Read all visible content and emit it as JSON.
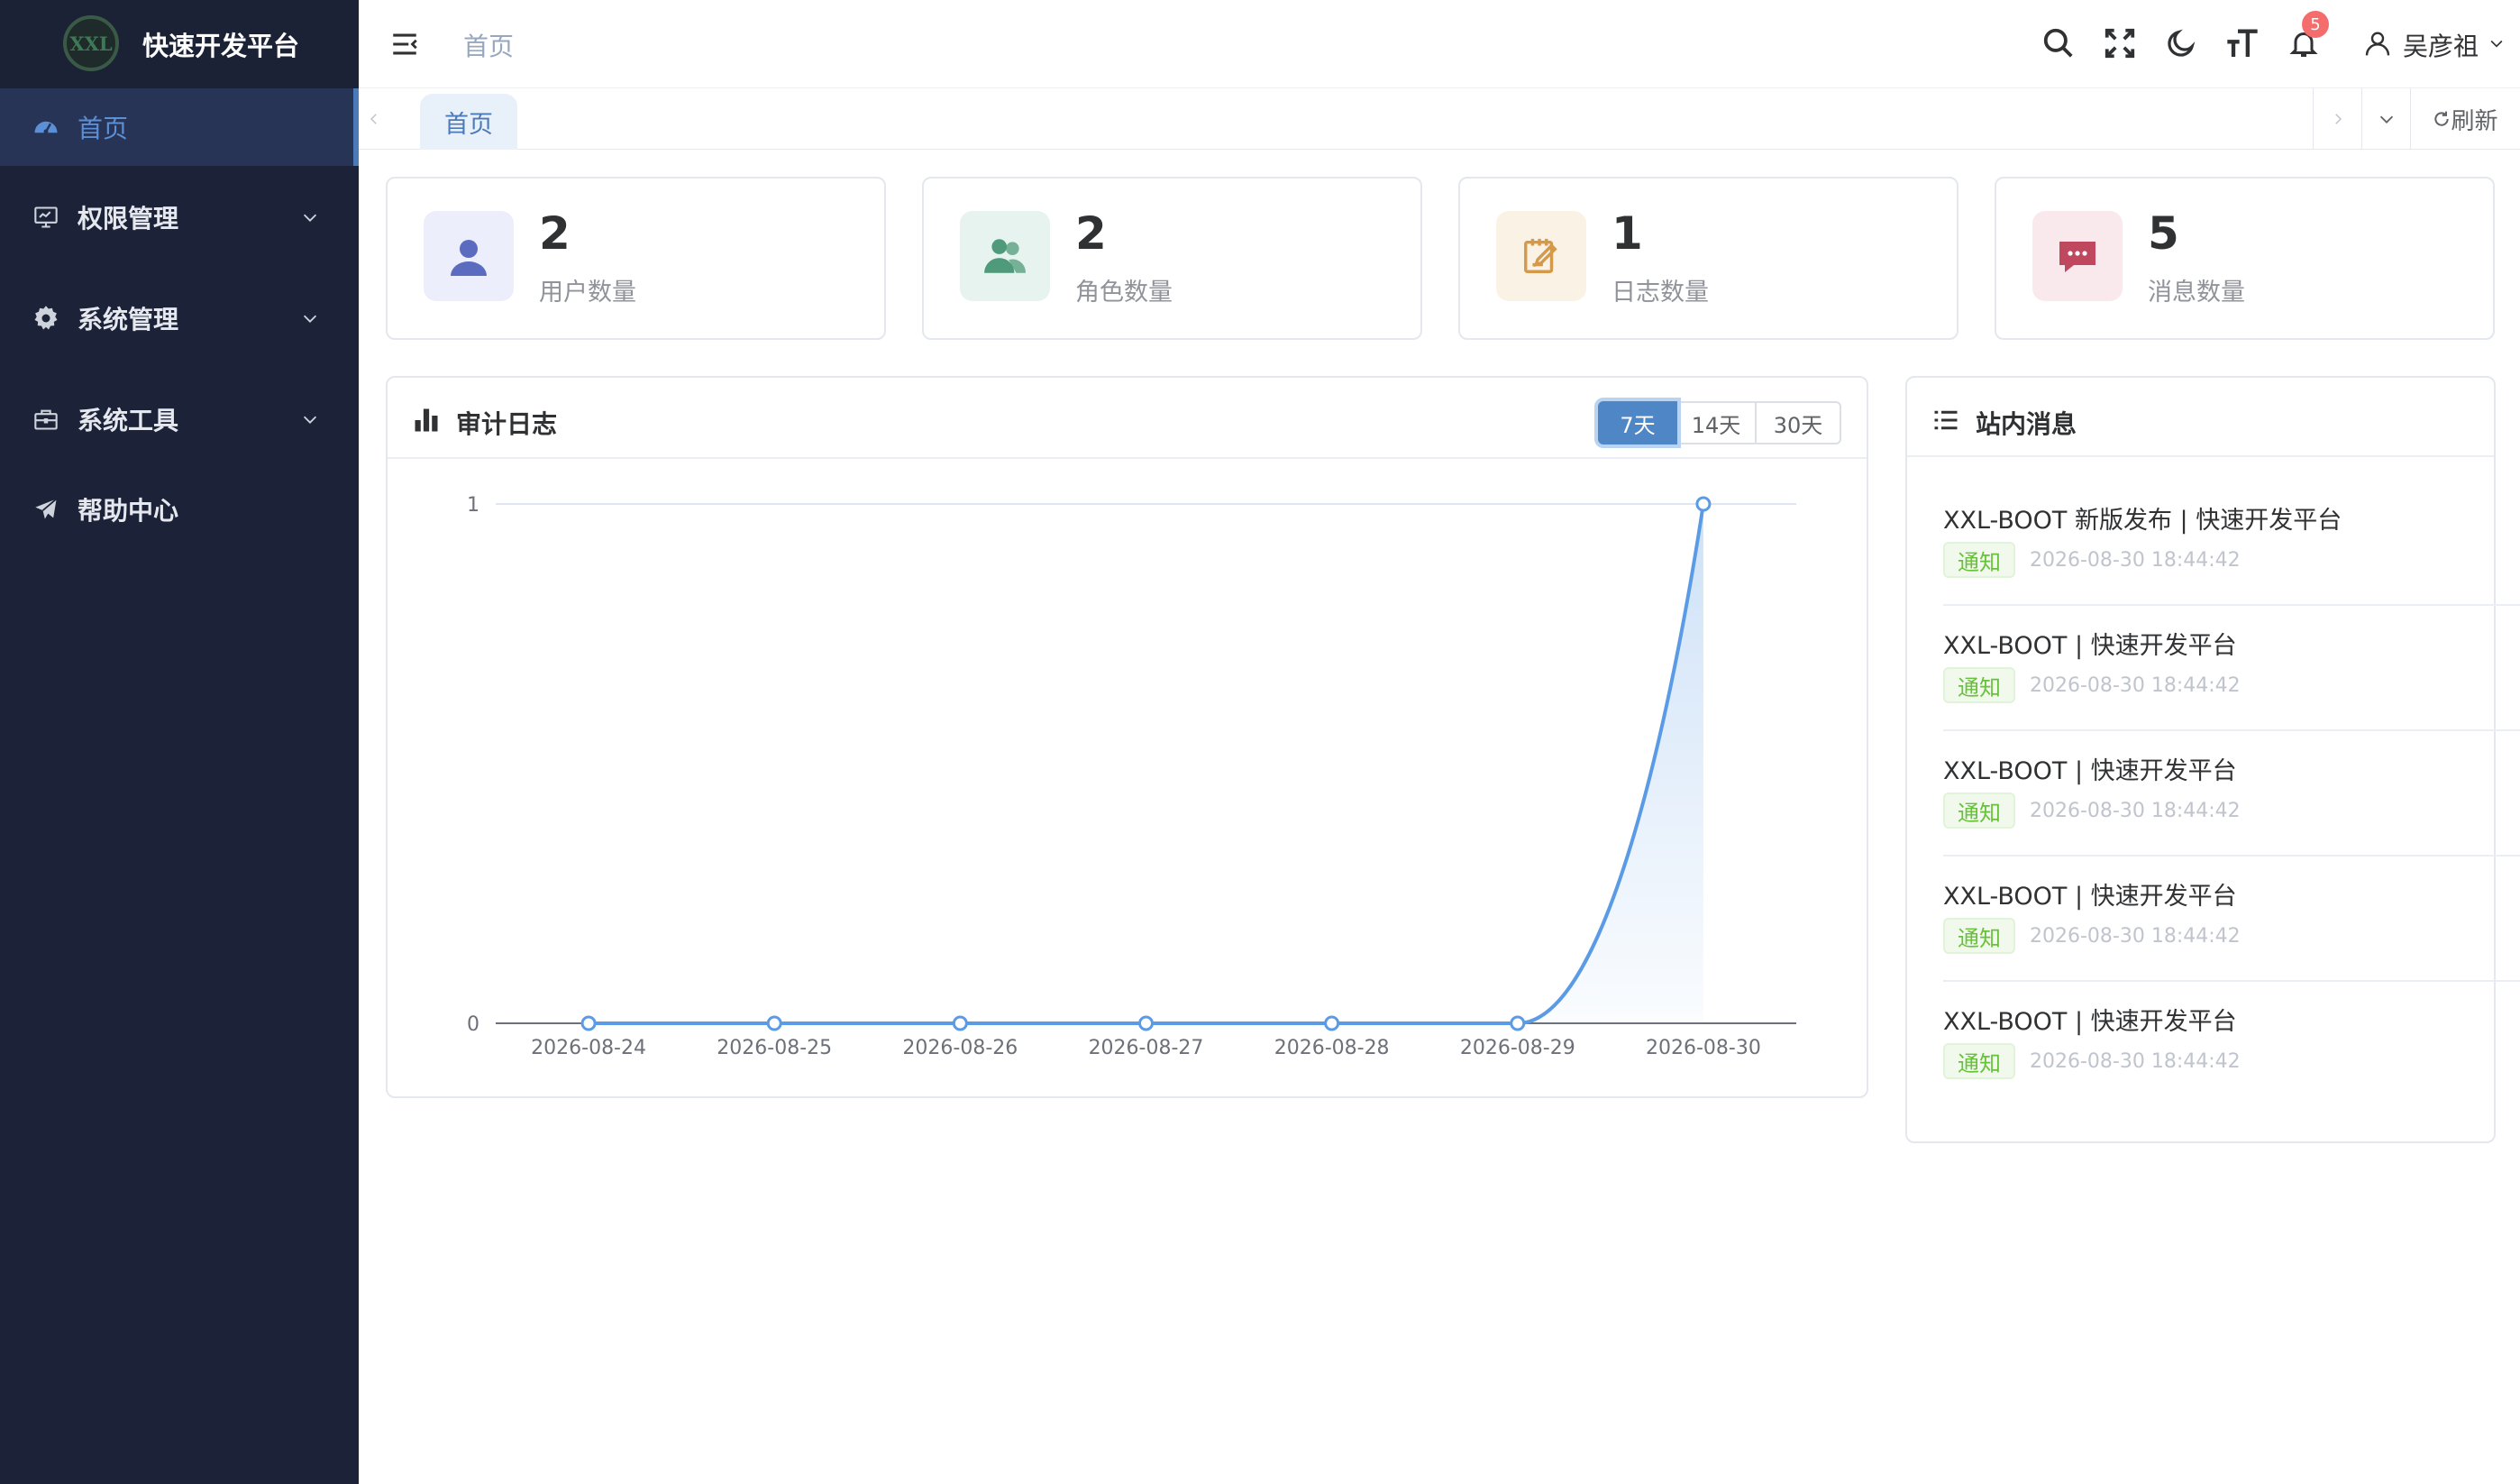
{
  "app": {
    "logo_text": "XXL",
    "title": "快速开发平台"
  },
  "sidebar": {
    "items": [
      {
        "label": "首页",
        "icon": "dashboard-icon",
        "active": true
      },
      {
        "label": "权限管理",
        "icon": "monitor-icon",
        "expandable": true
      },
      {
        "label": "系统管理",
        "icon": "gear-icon",
        "expandable": true
      },
      {
        "label": "系统工具",
        "icon": "briefcase-icon",
        "expandable": true
      },
      {
        "label": "帮助中心",
        "icon": "paper-plane-icon"
      }
    ]
  },
  "header": {
    "breadcrumb": "首页",
    "notification_count": "5",
    "user_name": "吴彦祖"
  },
  "tags": {
    "active_tag": "首页",
    "refresh_label": "刷新"
  },
  "stats": [
    {
      "value": "2",
      "label": "用户数量",
      "icon": "user-icon",
      "bg": "#eceefb",
      "color": "#5b6bc0"
    },
    {
      "value": "2",
      "label": "角色数量",
      "icon": "team-icon",
      "bg": "#e6f3ee",
      "color": "#4f9a7a"
    },
    {
      "value": "1",
      "label": "日志数量",
      "icon": "edit-icon",
      "bg": "#fbf2e6",
      "color": "#d49a4a"
    },
    {
      "value": "5",
      "label": "消息数量",
      "icon": "message-icon",
      "bg": "#f9e9ec",
      "color": "#c0485e"
    }
  ],
  "audit": {
    "title": "审计日志",
    "ranges": [
      "7天",
      "14天",
      "30天"
    ],
    "active_range": "7天"
  },
  "chart_data": {
    "type": "line",
    "categories": [
      "2026-08-24",
      "2026-08-25",
      "2026-08-26",
      "2026-08-27",
      "2026-08-28",
      "2026-08-29",
      "2026-08-30"
    ],
    "values": [
      0,
      0,
      0,
      0,
      0,
      0,
      1
    ],
    "y_ticks": [
      "0",
      "1"
    ],
    "ylim": [
      0,
      1
    ],
    "title": "",
    "xlabel": "",
    "ylabel": "",
    "smooth": true,
    "area_fill": true,
    "color": "#5b9be6"
  },
  "messages": {
    "title": "站内消息",
    "items": [
      {
        "title": "XXL-BOOT 新版发布 | 快速开发平台",
        "tag": "通知",
        "time": "2026-08-30 18:44:42"
      },
      {
        "title": "XXL-BOOT | 快速开发平台",
        "tag": "通知",
        "time": "2026-08-30 18:44:42"
      },
      {
        "title": "XXL-BOOT | 快速开发平台",
        "tag": "通知",
        "time": "2026-08-30 18:44:42"
      },
      {
        "title": "XXL-BOOT | 快速开发平台",
        "tag": "通知",
        "time": "2026-08-30 18:44:42"
      },
      {
        "title": "XXL-BOOT | 快速开发平台",
        "tag": "通知",
        "time": "2026-08-30 18:44:42"
      }
    ]
  }
}
